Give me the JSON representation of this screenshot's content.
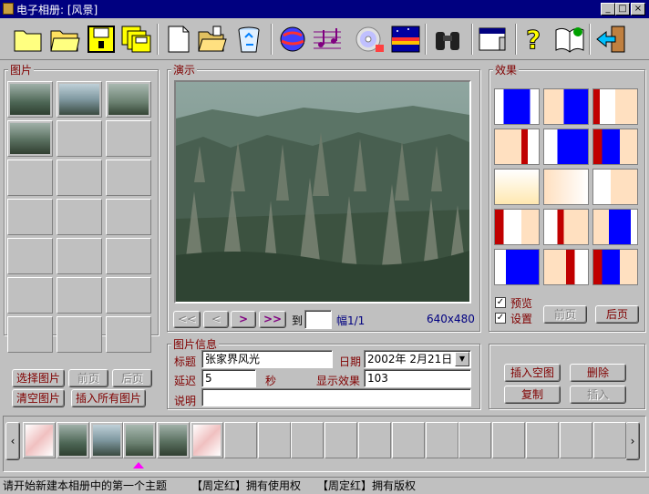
{
  "window": {
    "title": "电子相册: [风景]"
  },
  "toolbar": {
    "buttons": [
      {
        "icon": "new-album-icon"
      },
      {
        "icon": "open-album-icon"
      },
      {
        "icon": "save-icon"
      },
      {
        "icon": "save-all-icon"
      },
      {
        "icon": "new-page-icon"
      },
      {
        "icon": "open-folder-icon"
      },
      {
        "icon": "recycle-icon"
      },
      {
        "icon": "globe-icon"
      },
      {
        "icon": "music-icon"
      },
      {
        "icon": "cd-icon"
      },
      {
        "icon": "screen-icon"
      },
      {
        "icon": "binoculars-icon"
      },
      {
        "icon": "window-icon"
      },
      {
        "icon": "help-icon"
      },
      {
        "icon": "book-icon"
      },
      {
        "icon": "exit-icon"
      }
    ]
  },
  "pictures": {
    "label": "图片",
    "buttons": {
      "select": "选择图片",
      "prev": "前页",
      "next": "后页",
      "clear": "清空图片",
      "insert_all": "插入所有图片"
    }
  },
  "demo": {
    "label": "演示",
    "nav": {
      "first": "<<",
      "prev": "<",
      "next": ">",
      "last": ">>",
      "goto": "到",
      "page": "幅1/1",
      "resolution": "640x480"
    }
  },
  "effects": {
    "label": "效果",
    "preview": "预览",
    "settings": "设置",
    "prev": "前页",
    "next": "后页"
  },
  "info": {
    "label": "图片信息",
    "title_label": "标题",
    "title_value": "张家界风光",
    "date_label": "日期",
    "date_value": "2002年  2月21日",
    "delay_label": "延迟",
    "delay_value": "5",
    "delay_unit": "秒",
    "effect_label": "显示效果",
    "effect_value": "103",
    "desc_label": "说明",
    "desc_value": ""
  },
  "actions": {
    "insert_blank": "插入空图",
    "delete": "删除",
    "copy": "复制",
    "insert": "插入"
  },
  "status": {
    "message": "请开始新建本相册中的第一个主题",
    "rights1": "【周定红】拥有使用权",
    "rights2": "【周定红】拥有版权"
  },
  "colors": {
    "label": "#800000",
    "titlebar": "#000080",
    "face": "#c0c0c0"
  }
}
